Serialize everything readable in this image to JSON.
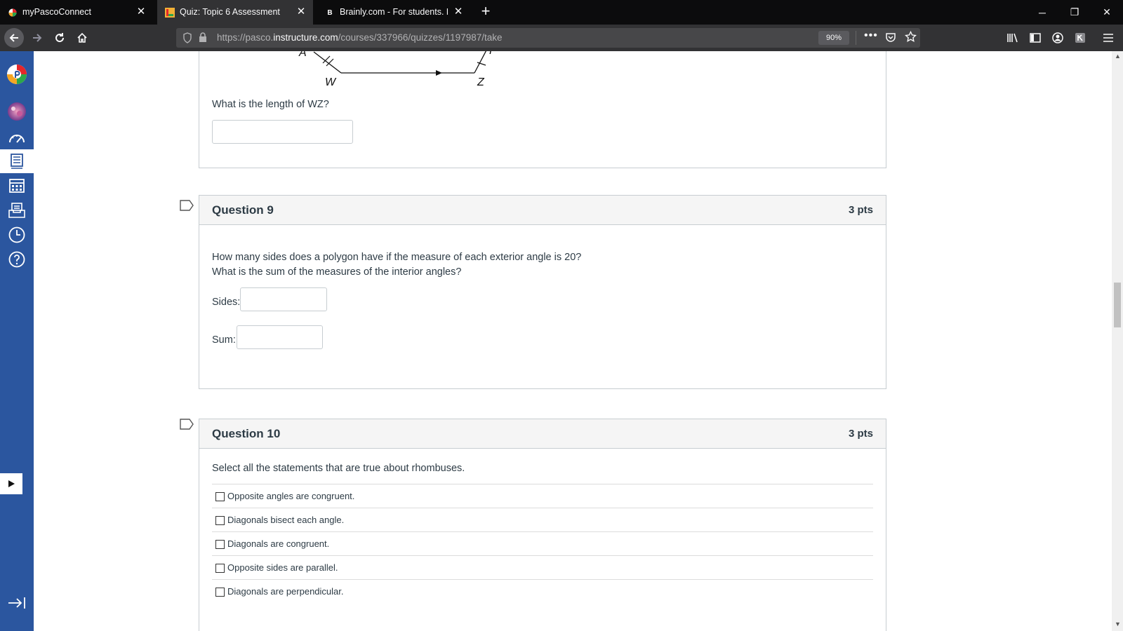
{
  "tabs": [
    {
      "title": "myPascoConnect",
      "favicon": "pasco-icon",
      "active": false
    },
    {
      "title": "Quiz: Topic 6 Assessment",
      "favicon": "canvas-quiz-icon",
      "active": true
    },
    {
      "title": "Brainly.com - For students. By",
      "favicon": "brainly-icon",
      "active": false
    }
  ],
  "url": {
    "prefix": "https://pasco.",
    "host": "instructure.com",
    "path": "/courses/337966/quizzes/1197987/take"
  },
  "zoom": "90%",
  "q8": {
    "figure": {
      "label_a": "A",
      "label_w": "W",
      "label_z": "Z",
      "label_f": "F"
    },
    "prompt": "What is the length of WZ?"
  },
  "q9": {
    "title": "Question 9",
    "points": "3 pts",
    "line1": "How many sides does a polygon have if the measure of each exterior angle is 20?",
    "line2": "What is the sum of the measures of the interior angles?",
    "sides_label": "Sides:",
    "sum_label": "Sum:"
  },
  "q10": {
    "title": "Question 10",
    "points": "3 pts",
    "prompt": "Select all the statements that are true about rhombuses.",
    "choices": [
      "Opposite angles are congruent.",
      "Diagonals bisect each angle.",
      "Diagonals are congruent.",
      "Opposite sides are parallel.",
      "Diagonals are perpendicular."
    ]
  },
  "colors": {
    "nav_bg": "#2b569f",
    "browser_dark": "#0c0c0d",
    "toolbar": "#323234"
  },
  "icons": [
    "canvas-logo-icon",
    "account-avatar-icon",
    "dashboard-icon",
    "courses-icon",
    "calendar-icon",
    "inbox-icon",
    "history-icon",
    "help-icon",
    "play-icon",
    "collapse-nav-icon"
  ]
}
